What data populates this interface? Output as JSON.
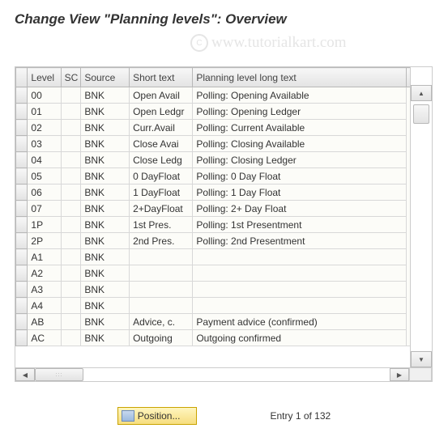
{
  "title": "Change View \"Planning levels\": Overview",
  "watermark": "www.tutorialkart.com",
  "columns": {
    "level": "Level",
    "sc": "SC",
    "source": "Source",
    "short": "Short text",
    "long": "Planning level long text"
  },
  "rows": [
    {
      "level": "00",
      "sc": "",
      "source": "BNK",
      "short": "Open Avail",
      "long": "Polling: Opening Available"
    },
    {
      "level": "01",
      "sc": "",
      "source": "BNK",
      "short": "Open Ledgr",
      "long": "Polling: Opening Ledger"
    },
    {
      "level": "02",
      "sc": "",
      "source": "BNK",
      "short": "Curr.Avail",
      "long": "Polling: Current Available"
    },
    {
      "level": "03",
      "sc": "",
      "source": "BNK",
      "short": "Close Avai",
      "long": "Polling: Closing Available"
    },
    {
      "level": "04",
      "sc": "",
      "source": "BNK",
      "short": "Close Ledg",
      "long": "Polling: Closing Ledger"
    },
    {
      "level": "05",
      "sc": "",
      "source": "BNK",
      "short": "0 DayFloat",
      "long": "Polling: 0 Day Float"
    },
    {
      "level": "06",
      "sc": "",
      "source": "BNK",
      "short": "1 DayFloat",
      "long": "Polling: 1 Day Float"
    },
    {
      "level": "07",
      "sc": "",
      "source": "BNK",
      "short": "2+DayFloat",
      "long": "Polling: 2+ Day Float"
    },
    {
      "level": "1P",
      "sc": "",
      "source": "BNK",
      "short": "1st Pres.",
      "long": "Polling: 1st Presentment"
    },
    {
      "level": "2P",
      "sc": "",
      "source": "BNK",
      "short": "2nd Pres.",
      "long": "Polling: 2nd Presentment"
    },
    {
      "level": "A1",
      "sc": "",
      "source": "BNK",
      "short": "",
      "long": ""
    },
    {
      "level": "A2",
      "sc": "",
      "source": "BNK",
      "short": "",
      "long": ""
    },
    {
      "level": "A3",
      "sc": "",
      "source": "BNK",
      "short": "",
      "long": ""
    },
    {
      "level": "A4",
      "sc": "",
      "source": "BNK",
      "short": "",
      "long": ""
    },
    {
      "level": "AB",
      "sc": "",
      "source": "BNK",
      "short": "Advice, c.",
      "long": "Payment advice (confirmed)"
    },
    {
      "level": "AC",
      "sc": "",
      "source": "BNK",
      "short": "Outgoing",
      "long": "Outgoing confirmed"
    }
  ],
  "footer": {
    "position_label": "Position...",
    "entry_label": "Entry 1 of 132"
  }
}
